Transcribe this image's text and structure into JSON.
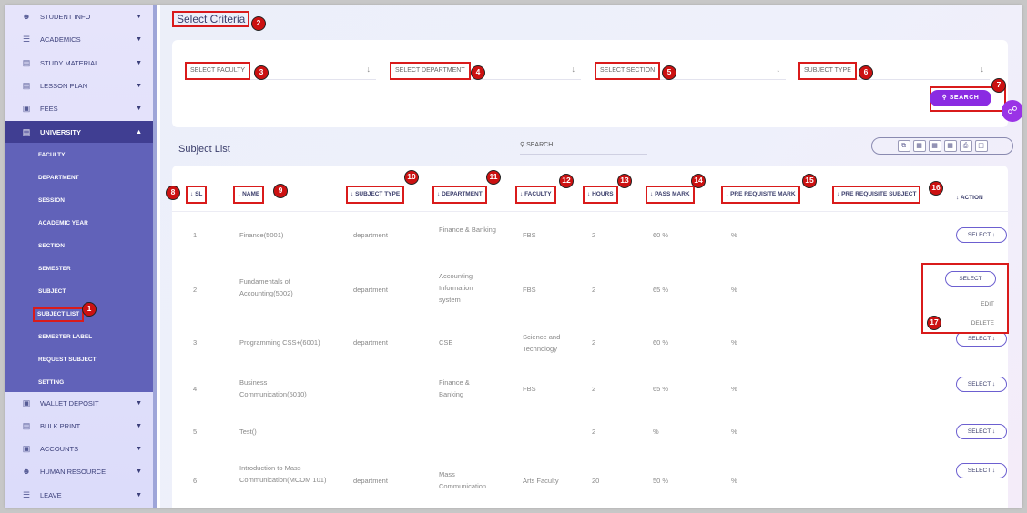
{
  "sidebar": {
    "items": [
      {
        "label": "Student Info",
        "icon": "student-icon"
      },
      {
        "label": "Academics",
        "icon": "academics-icon"
      },
      {
        "label": "Study Material",
        "icon": "study-material-icon"
      },
      {
        "label": "Lesson Plan",
        "icon": "lesson-plan-icon"
      },
      {
        "label": "Fees",
        "icon": "fees-icon"
      },
      {
        "label": "University",
        "icon": "university-icon"
      },
      {
        "label": "Wallet Deposit",
        "icon": "wallet-icon"
      },
      {
        "label": "Bulk Print",
        "icon": "print-icon"
      },
      {
        "label": "Accounts",
        "icon": "accounts-icon"
      },
      {
        "label": "Human Resource",
        "icon": "human-resource-icon"
      },
      {
        "label": "Leave",
        "icon": "leave-icon"
      }
    ],
    "sub_items": [
      "Faculty",
      "Department",
      "Session",
      "Academic Year",
      "Section",
      "Semester",
      "Subject",
      "Subject List",
      "Semester Label",
      "Request Subject",
      "Setting"
    ]
  },
  "criteria": {
    "title": "Select Criteria",
    "faculty": "SELECT FACULTY",
    "department": "SELECT DEPARTMENT",
    "section": "SELECT SECTION",
    "subject_type": "SUBJECT TYPE",
    "search_button": "SEARCH"
  },
  "list": {
    "title": "Subject List",
    "search_placeholder": "SEARCH"
  },
  "table": {
    "headers": [
      "SL",
      "NAME",
      "SUBJECT TYPE",
      "DEPARTMENT",
      "FACULTY",
      "HOURS",
      "PASS MARK",
      "PRE REQUISITE MARK",
      "PRE REQUISITE SUBJECT",
      "ACTION"
    ],
    "rows": [
      {
        "sl": "1",
        "name": "Finance(5001)",
        "type": "department",
        "department": "Finance & Banking",
        "faculty": "FBS",
        "hours": "2",
        "pass": "60 %",
        "pre_mark": "%",
        "action": "SELECT"
      },
      {
        "sl": "2",
        "name": "Fundamentals of Accounting(5002)",
        "type": "department",
        "department": "Accounting Information system",
        "faculty": "FBS",
        "hours": "2",
        "pass": "65 %",
        "pre_mark": "%",
        "action": "SELECT"
      },
      {
        "sl": "3",
        "name": "Programming CSS+(6001)",
        "type": "department",
        "department": "CSE",
        "faculty": "Science and Technology",
        "hours": "2",
        "pass": "60 %",
        "pre_mark": "%",
        "action": "SELECT"
      },
      {
        "sl": "4",
        "name": "Business Communication(5010)",
        "type": "",
        "department": "Finance & Banking",
        "faculty": "FBS",
        "hours": "2",
        "pass": "65 %",
        "pre_mark": "%",
        "action": "SELECT"
      },
      {
        "sl": "5",
        "name": "Test()",
        "type": "",
        "department": "",
        "faculty": "",
        "hours": "2",
        "pass": "%",
        "pre_mark": "%",
        "action": "SELECT"
      },
      {
        "sl": "6",
        "name": "Introduction to Mass Communication(MCOM 101)",
        "type": "department",
        "department": "Mass Communication",
        "faculty": "Arts Faculty",
        "hours": "20",
        "pass": "50 %",
        "pre_mark": "%",
        "action": "SELECT"
      }
    ]
  },
  "dropdown": {
    "select": "SELECT",
    "edit": "EDIT",
    "delete": "DELETE"
  },
  "badges": [
    "1",
    "2",
    "3",
    "4",
    "5",
    "6",
    "7",
    "8",
    "9",
    "10",
    "11",
    "12",
    "13",
    "14",
    "15",
    "16",
    "17"
  ],
  "colors": {
    "accent": "#8a2be2",
    "sidebar_active": "#403e92",
    "highlight": "#d91b1b"
  }
}
